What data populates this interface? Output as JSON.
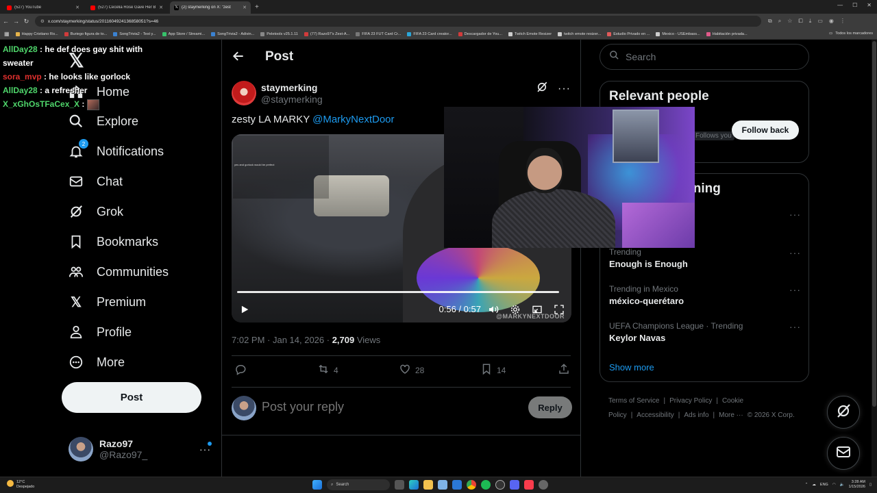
{
  "browser": {
    "tabs": [
      {
        "label": "(527) YouTube",
        "color": "#ff0000",
        "active": false
      },
      {
        "label": "(527) Cecelia Rose Gave Her B",
        "color": "#ff0000",
        "active": false
      },
      {
        "label": "(2) staymerking on X: \"zest",
        "color": "#ffffff",
        "active": true
      }
    ],
    "url": "x.com/staymerking/status/2011604924136858051?s=46",
    "bookmarks": [
      {
        "label": "Happy Cristiano Ro...",
        "color": "#e6b34a"
      },
      {
        "label": "Buriego figura de to...",
        "color": "#d13b3b"
      },
      {
        "label": "SongTrivia2 - Test y...",
        "color": "#3b82d1"
      },
      {
        "label": "App Store / Streami...",
        "color": "#37c26b"
      },
      {
        "label": "SongTrivia2 - Adivin...",
        "color": "#3b82d1"
      },
      {
        "label": "Peletools v25.1.11",
        "color": "#888888"
      },
      {
        "label": "(77) Razo97's Zest-A...",
        "color": "#d13b3b"
      },
      {
        "label": "FIFA 23 FUT Card Cr...",
        "color": "#777777"
      },
      {
        "label": "FIFA 23 Card creator...",
        "color": "#2aa6d9"
      },
      {
        "label": "Descargador de You...",
        "color": "#d13b3b"
      },
      {
        "label": "Twitch Emote Resizer",
        "color": "#cccccc"
      },
      {
        "label": "twitch emote resizer...",
        "color": "#cccccc"
      },
      {
        "label": "Estudio Privado en ...",
        "color": "#e05a5a"
      },
      {
        "label": "Mexico - USEmbass...",
        "color": "#cccccc"
      },
      {
        "label": "Habitación privada...",
        "color": "#e05a8a"
      }
    ],
    "bookmarks_folder": "Todos los marcadores"
  },
  "chat": [
    {
      "user": "AllDay28",
      "user_color": "#4fd66b",
      "message": "he def does gay shit with sweater"
    },
    {
      "user": "sora_mvp",
      "user_color": "#e0302e",
      "message": "he looks like gorlock"
    },
    {
      "user": "AllDay28",
      "user_color": "#4fd66b",
      "message": "a refresher"
    },
    {
      "user": "X_xGhOsTFaCex_X",
      "user_color": "#4fd66b",
      "message": ""
    }
  ],
  "nav": {
    "items": [
      {
        "label": "Home",
        "icon": "home-icon"
      },
      {
        "label": "Explore",
        "icon": "search-icon"
      },
      {
        "label": "Notifications",
        "icon": "bell-icon",
        "badge": "2"
      },
      {
        "label": "Chat",
        "icon": "mail-icon"
      },
      {
        "label": "Grok",
        "icon": "grok-icon"
      },
      {
        "label": "Bookmarks",
        "icon": "bookmark-icon"
      },
      {
        "label": "Communities",
        "icon": "communities-icon"
      },
      {
        "label": "Premium",
        "icon": "x-icon"
      },
      {
        "label": "Profile",
        "icon": "person-icon"
      },
      {
        "label": "More",
        "icon": "more-circle-icon"
      }
    ],
    "post_label": "Post",
    "account": {
      "name": "Razo97",
      "handle": "@Razo97_"
    }
  },
  "post": {
    "header_title": "Post",
    "author_name": "staymerking",
    "author_handle": "@staymerking",
    "text": "zesty LA MARKY ",
    "mention": "@MarkyNextDoor",
    "video": {
      "time": "0:56 / 0:57",
      "progress": 0.98,
      "watermark": "@MARKYNEXTDOOR",
      "chat_lines": [
        "yes and gorlock would be perfect"
      ]
    },
    "timestamp": "7:02 PM · Jan 14, 2026 · ",
    "views_count": "2,709",
    "views_label": " Views",
    "reposts": "4",
    "likes": "28",
    "bookmarks": "14",
    "reply_placeholder": "Post your reply",
    "reply_button": "Reply"
  },
  "sidebar": {
    "search_placeholder": "Search",
    "relevant_title": "Relevant people",
    "follow_back": "Follow back",
    "follows_you": "Follows you",
    "trending_title": "What's happening",
    "trends": [
      {
        "category": "Trending",
        "name": "Enough is Enough"
      },
      {
        "category": "Trending in Mexico",
        "name": "méxico-querétaro"
      },
      {
        "category": "UEFA Champions League · Trending",
        "name": "Keylor Navas"
      }
    ],
    "show_more": "Show more",
    "footer": [
      "Terms of Service",
      "|",
      "Privacy Policy",
      "|",
      "Cookie Policy",
      "|",
      "Accessibility",
      "|",
      "Ads info",
      "|",
      "More ···",
      "© 2026 X Corp."
    ]
  },
  "taskbar": {
    "weather_temp": "12°C",
    "weather_desc": "Despejado",
    "search_label": "Search",
    "lang": "ENG",
    "time": "3:28 AM",
    "date": "1/15/2026"
  },
  "colors": {
    "accent": "#1d9bf0",
    "bg": "#000000",
    "border": "#2f3336",
    "muted": "#71767b"
  }
}
